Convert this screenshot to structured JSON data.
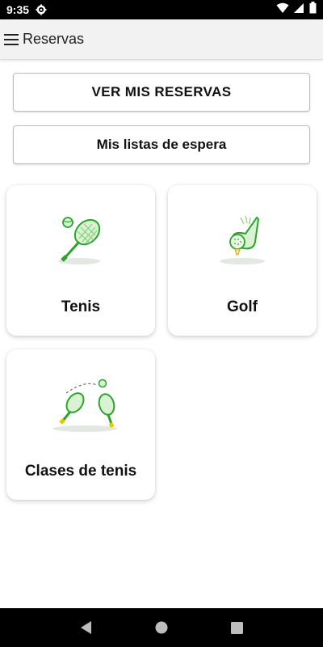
{
  "status_bar": {
    "time": "9:35",
    "icons": [
      "gear-icon",
      "wifi-icon",
      "signal-icon",
      "battery-icon"
    ]
  },
  "app_bar": {
    "title": "Reservas",
    "menu_icon": "hamburger-menu-icon"
  },
  "buttons": {
    "ver_reservas": "VER MIS RESERVAS",
    "listas_espera": "Mis listas de espera"
  },
  "cards": [
    {
      "label": "Tenis",
      "icon": "tennis-racket-icon"
    },
    {
      "label": "Golf",
      "icon": "golf-club-icon"
    },
    {
      "label": "Clases de tenis",
      "icon": "tennis-lessons-icon"
    }
  ],
  "nav_bar": {
    "icons": [
      "back-icon",
      "home-icon",
      "recents-icon"
    ]
  },
  "colors": {
    "accent": "#4cc24a",
    "card_shadow": "#e0e0e0"
  }
}
